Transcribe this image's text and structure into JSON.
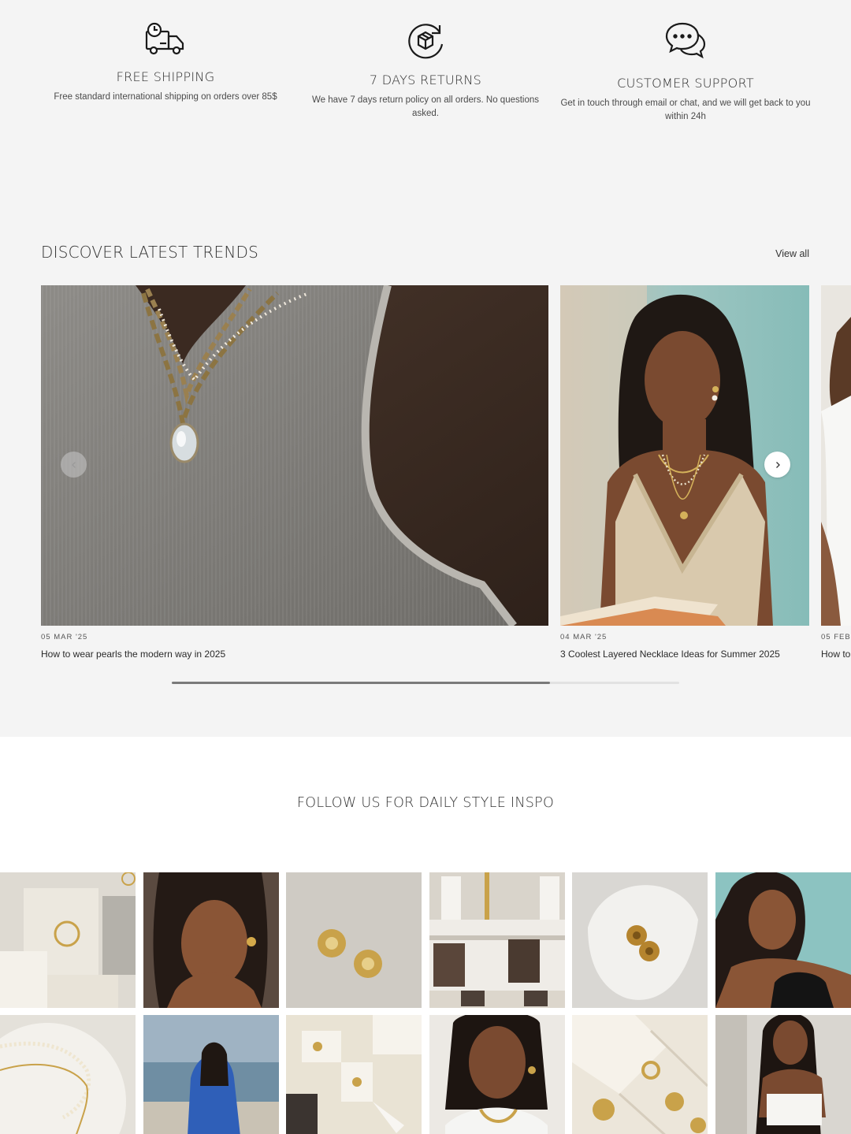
{
  "features": [
    {
      "icon": "delivery-truck-icon",
      "title": "FREE SHIPPING",
      "description": "Free standard international shipping on orders over 85$"
    },
    {
      "icon": "return-box-icon",
      "title": "7 DAYS RETURNS",
      "description": "We have 7 days return policy on all orders. No questions asked."
    },
    {
      "icon": "chat-bubbles-icon",
      "title": "CUSTOMER SUPPORT",
      "description": "Get in touch through email or chat, and we will get back to you within 24h"
    }
  ],
  "trends": {
    "title": "DISCOVER LATEST TRENDS",
    "view_all": "View all",
    "cards": [
      {
        "date": "05 MAR '25",
        "title": "How to wear pearls the modern way in 2025"
      },
      {
        "date": "04 MAR '25",
        "title": "3 Coolest Layered Necklace Ideas for Summer 2025"
      },
      {
        "date": "05 FEB '",
        "title": "How to"
      }
    ],
    "scroll_progress": 0.745
  },
  "follow": {
    "title": "FOLLOW US FOR DAILY STYLE INSPO"
  },
  "colors": {
    "band_background": "#f4f4f4",
    "page_background": "#ffffff",
    "gold": "#c9a24a"
  }
}
